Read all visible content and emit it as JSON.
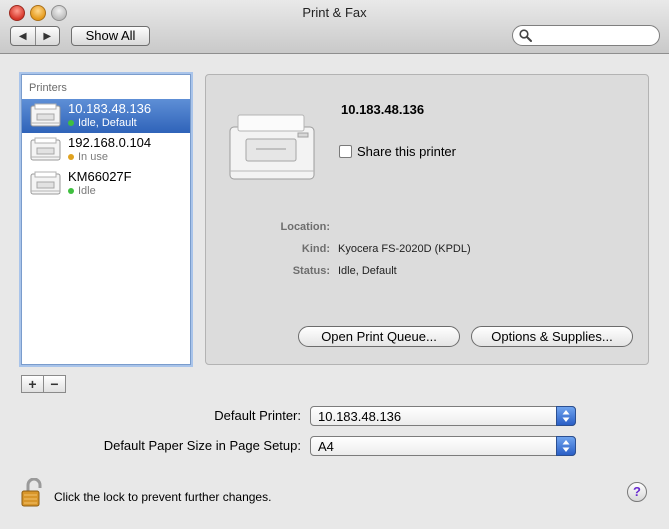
{
  "window": {
    "title": "Print & Fax",
    "toolbar": {
      "back_label": "◀",
      "forward_label": "▶",
      "show_all_label": "Show All",
      "search_placeholder": "",
      "search_value": ""
    }
  },
  "sidebar": {
    "header": "Printers",
    "printers": [
      {
        "name": "10.183.48.136",
        "status": "Idle, Default",
        "status_color": "#3fbf3f",
        "selected": true
      },
      {
        "name": "192.168.0.104",
        "status": "In use",
        "status_color": "#e0a21f",
        "selected": false
      },
      {
        "name": "KM66027F",
        "status": "Idle",
        "status_color": "#3fbf3f",
        "selected": false
      }
    ],
    "add_label": "+",
    "remove_label": "−"
  },
  "detail": {
    "printer_name": "10.183.48.136",
    "share_label": "Share this printer",
    "share_checked": false,
    "location_label": "Location:",
    "location_value": "",
    "kind_label": "Kind:",
    "kind_value": "Kyocera FS-2020D (KPDL)",
    "status_label": "Status:",
    "status_value": "Idle, Default",
    "open_queue_label": "Open Print Queue...",
    "options_label": "Options & Supplies..."
  },
  "defaults": {
    "default_printer_label": "Default Printer:",
    "default_printer_value": "10.183.48.136",
    "paper_size_label": "Default Paper Size in Page Setup:",
    "paper_size_value": "A4"
  },
  "footer": {
    "lock_text": "Click the lock to prevent further changes.",
    "help_label": "?"
  },
  "colors": {
    "selection": "#3a6fc4",
    "popup_arrows": "#3f74d9",
    "help_glyph": "#6a2bd0"
  }
}
